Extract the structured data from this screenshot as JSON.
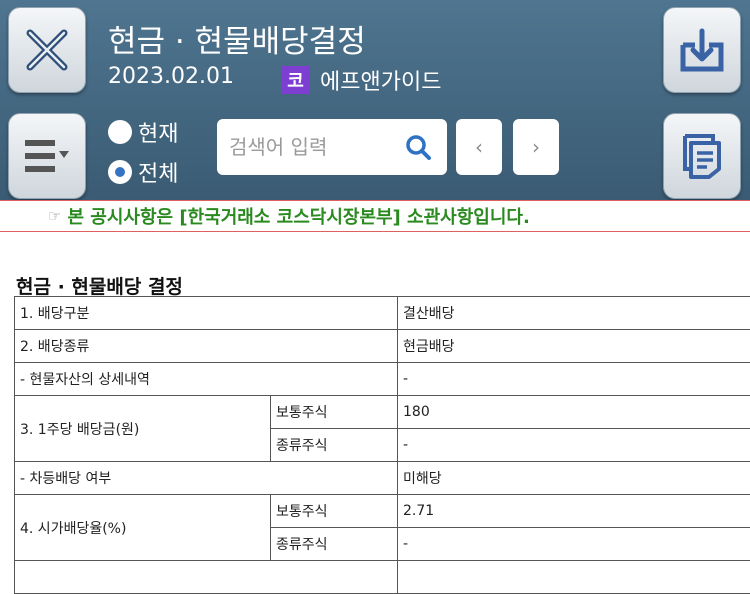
{
  "header": {
    "title": "현금 · 현물배당결정",
    "date": "2023.02.01",
    "market_badge": "코",
    "company": "에프앤가이드",
    "radios": [
      {
        "label": "현재",
        "checked": false
      },
      {
        "label": "전체",
        "checked": true
      }
    ],
    "search_placeholder": "검색어 입력",
    "prev_label": "‹",
    "next_label": "›",
    "icons": {
      "close": "close-x-icon",
      "download": "download-icon",
      "menu": "menu-dropdown-icon",
      "copy": "document-copy-icon",
      "search": "search-icon"
    },
    "badge_color": "#7d3fd1"
  },
  "notice": {
    "glyph": "☞",
    "text": "본 공시사항은 [한국거래소 코스닥시장본부] 소관사항입니다."
  },
  "section_title": "현금 · 현물배당 결정",
  "table": {
    "r1": {
      "label": "1. 배당구분",
      "value": "결산배당"
    },
    "r2": {
      "label": "2. 배당종류",
      "value": "현금배당"
    },
    "r3": {
      "label": "- 현물자산의 상세내역",
      "value": "-"
    },
    "r4": {
      "label": "3. 1주당 배당금(원)",
      "sub1": "보통주식",
      "val1": "180",
      "sub2": "종류주식",
      "val2": "-"
    },
    "r5": {
      "label": "- 차등배당 여부",
      "value": "미해당"
    },
    "r6": {
      "label": "4. 시가배당율(%)",
      "sub1": "보통주식",
      "val1": "2.71",
      "sub2": "종류주식",
      "val2": "-"
    }
  }
}
